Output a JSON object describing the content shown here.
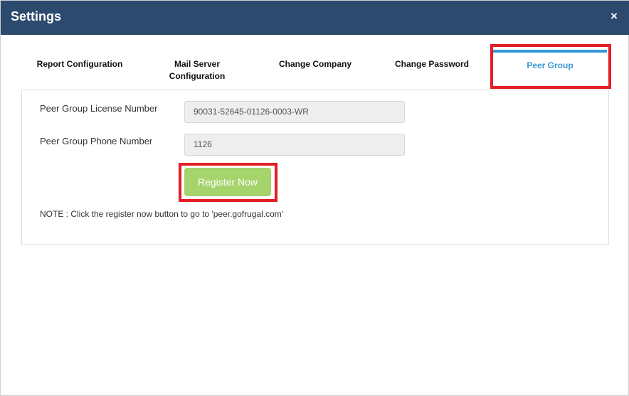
{
  "dialog": {
    "title": "Settings",
    "close_icon": "×"
  },
  "tabs": [
    {
      "label": "Report Configuration",
      "active": false
    },
    {
      "label_line1": "Mail Server",
      "label_line2": "Configuration",
      "active": false
    },
    {
      "label": "Change Company",
      "active": false
    },
    {
      "label": "Change Password",
      "active": false
    },
    {
      "label": "Peer Group",
      "active": true
    }
  ],
  "peer_group": {
    "license_label": "Peer Group License Number",
    "license_value": "90031-52645-01126-0003-WR",
    "phone_label": "Peer Group Phone Number",
    "phone_value": "1126",
    "register_button": "Register Now",
    "note": "NOTE : Click the register now button to go to 'peer.gofrugal.com'"
  },
  "colors": {
    "header_bg": "#2b4a6d",
    "active_tab": "#3a97d4",
    "highlight": "#e31e24",
    "register_button": "#a5d36c"
  }
}
